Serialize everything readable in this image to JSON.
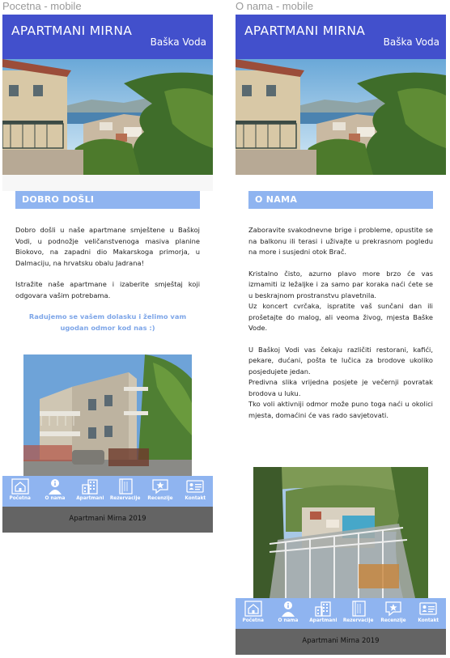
{
  "artboards": [
    {
      "label": "Pocetna - mobile",
      "brand": "APARTMANI MIRNA",
      "town": "Baška Voda",
      "section_title": "DOBRO DOŠLI",
      "paragraphs": [
        "Dobro došli u naše apartmane smještene u Baškoj Vodi, u podnožje veličanstvenoga masiva planine Biokovo, na zapadni dio Makarskoga primorja, u Dalmaciju, na hrvatsku obalu Jadrana!",
        "Istražite naše apartmane i izaberite smještaj koji odgovara vašim potrebama."
      ],
      "highlight": "Radujemo se vašem dolasku i želimo vam ugodan odmor kod nas :)",
      "footer": "Apartmani Mirna 2019"
    },
    {
      "label": "O nama - mobile",
      "brand": "APARTMANI MIRNA",
      "town": "Baška Voda",
      "section_title": "O NAMA",
      "paragraphs": [
        "Zaboravite svakodnevne brige i probleme, opustite se na balkonu ili terasi i uživajte u prekrasnom pogledu na more i susjedni otok Brač.",
        "Kristalno čisto, azurno plavo more brzo će vas izmamiti iz ležaljke i za samo par koraka naći ćete se u beskrajnom prostranstvu plavetnila.",
        "Uz koncert cvrčaka, ispratite vaš sunčani dan ili prošetajte do malog, ali veoma živog, mjesta Baške Vode.",
        "U Baškoj Vodi vas čekaju različiti restorani, kafići, pekare, dućani, pošta te lučica za brodove ukoliko posjedujete jedan.",
        "Predivna slika vrijedna posjete je večernji povratak brodova u luku.",
        "Tko voli aktivniji odmor može puno toga naći u okolici mjesta, domaćini će vas rado savjetovati."
      ],
      "footer": "Apartmani Mirna 2019"
    }
  ],
  "nav": [
    {
      "label": "Početna",
      "icon": "home-icon"
    },
    {
      "label": "O nama",
      "icon": "person-info-icon"
    },
    {
      "label": "Apartmani",
      "icon": "building-icon"
    },
    {
      "label": "Rezervacije",
      "icon": "book-icon"
    },
    {
      "label": "Recenzije",
      "icon": "review-star-icon"
    },
    {
      "label": "Kontakt",
      "icon": "contact-card-icon"
    }
  ],
  "colors": {
    "header": "#4250cc",
    "accent": "#8fb4f0",
    "footer": "#646464",
    "highlight_text": "#7ea6e8"
  }
}
